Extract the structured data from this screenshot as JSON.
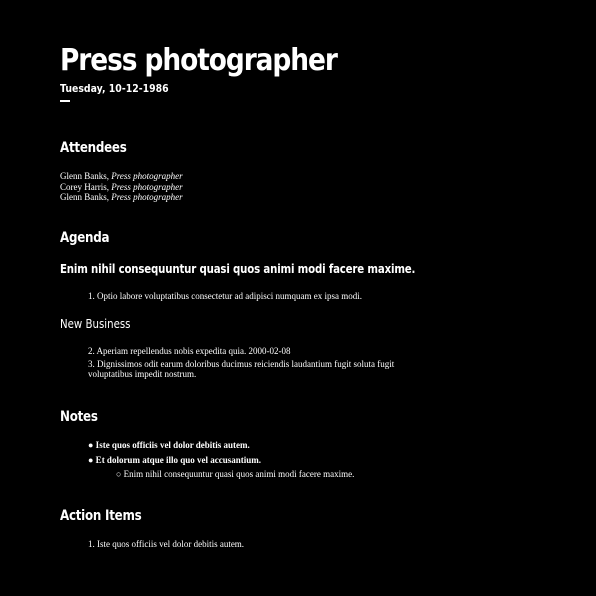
{
  "header": {
    "title": "Press photographer",
    "date": "Tuesday, 10-12-1986"
  },
  "attendees": {
    "heading": "Attendees",
    "people": [
      {
        "name": "Glenn Banks, ",
        "role": "Press photographer"
      },
      {
        "name": "Corey Harris, ",
        "role": "Press photographer"
      },
      {
        "name": "Glenn Banks, ",
        "role": "Press photographer"
      }
    ]
  },
  "agenda": {
    "heading": "Agenda",
    "subheading": "Enim nihil consequuntur quasi quos animi modi facere maxime.",
    "items": [
      "1. Optio labore voluptatibus consectetur ad adipisci numquam ex ipsa modi."
    ],
    "new_business_heading": "New Business",
    "new_business_items": [
      "2. Aperiam repellendus nobis expedita quia. 2000-02-08",
      "3. Dignissimos odit earum doloribus ducimus reiciendis laudantium fugit soluta fugit voluptatibus impedit nostrum."
    ]
  },
  "notes": {
    "heading": "Notes",
    "bullets": [
      "● Iste quos officiis vel dolor debitis autem.",
      "● Et dolorum atque illo quo vel accusantium."
    ],
    "sub_bullets": [
      "○ Enim nihil consequuntur quasi quos animi modi facere maxime."
    ]
  },
  "action_items": {
    "heading": "Action Items",
    "items": [
      "1. Iste quos officiis vel dolor debitis autem."
    ]
  }
}
